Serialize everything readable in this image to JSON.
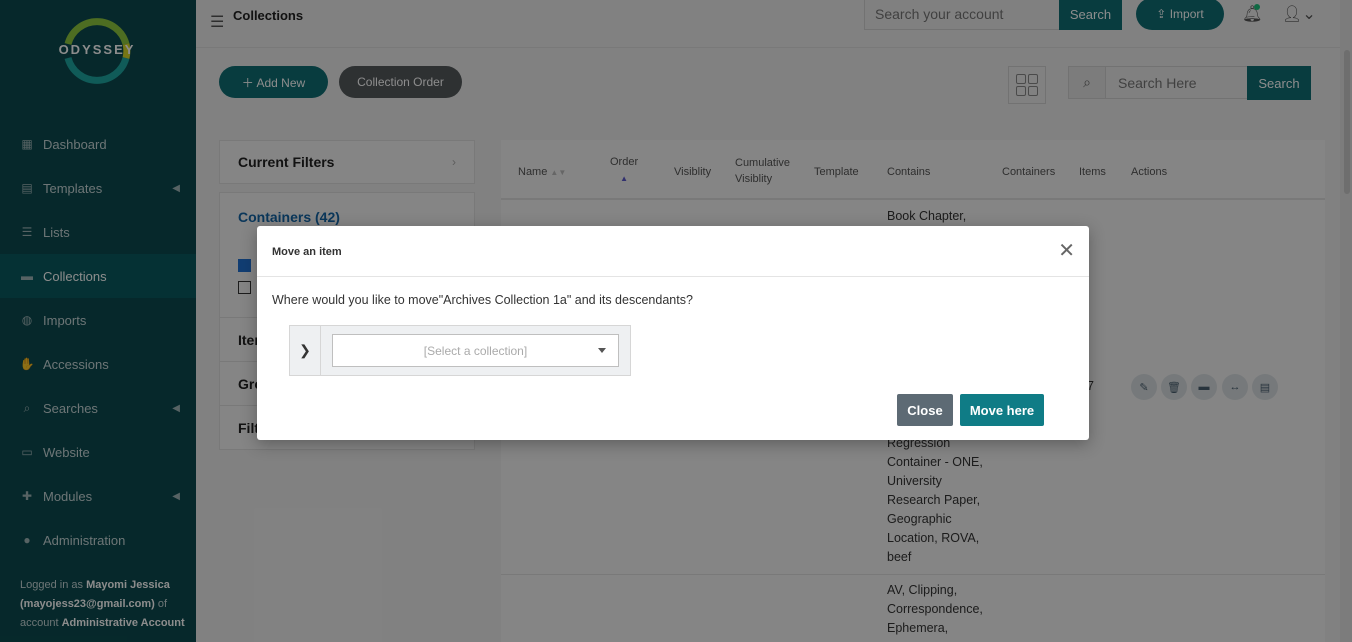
{
  "sidebar": {
    "logo_text": "ODYSSEY",
    "items": [
      {
        "label": "Dashboard",
        "icon": "dashboard-icon"
      },
      {
        "label": "Templates",
        "icon": "document-icon",
        "has_children": true
      },
      {
        "label": "Lists",
        "icon": "list-icon"
      },
      {
        "label": "Collections",
        "icon": "archive-box-icon",
        "active": true
      },
      {
        "label": "Imports",
        "icon": "database-icon"
      },
      {
        "label": "Accessions",
        "icon": "handshake-icon"
      },
      {
        "label": "Searches",
        "icon": "search-icon",
        "has_children": true
      },
      {
        "label": "Website",
        "icon": "monitor-icon"
      },
      {
        "label": "Modules",
        "icon": "puzzle-icon",
        "has_children": true
      },
      {
        "label": "Administration",
        "icon": "user-icon"
      }
    ],
    "login": {
      "prefix": "Logged in as ",
      "name": "Mayomi Jessica",
      "email": "(mayojess23@gmail.com)",
      "of_account": " of account ",
      "account": "Administrative Account"
    }
  },
  "topbar": {
    "title": "Collections",
    "search_placeholder": "Search your account",
    "search_label": "Search",
    "import_label": "Import"
  },
  "toolbar": {
    "add_new_label": "Add New",
    "collection_order_label": "Collection Order",
    "search_placeholder": "Search Here",
    "search_label": "Search"
  },
  "filters": {
    "current_filters": "Current Filters",
    "containers": "Containers (42)",
    "items": "Iter",
    "groups": "Gro",
    "filters": "Filt"
  },
  "table": {
    "headers": {
      "name": "Name",
      "order": "Order",
      "visibility": "Visiblity",
      "cumulative_1": "Cumulative",
      "cumulative_2": "Visiblity",
      "template": "Template",
      "contains": "Contains",
      "containers": "Containers",
      "items": "Items",
      "actions": "Actions"
    },
    "row1_contains_top": "Book Chapter,",
    "row1_partial_value": "7",
    "row1_contains_lines": [
      "Regression",
      "Container - ONE,",
      "University",
      "Research Paper,",
      "Geographic",
      "Location, ROVA,",
      "beef"
    ],
    "row2_contains_lines": [
      "AV, Clipping,",
      "Correspondence,",
      "Ephemera,"
    ]
  },
  "modal": {
    "title": "Move an item",
    "question": "Where would you like to move\"Archives Collection 1a\" and its descendants?",
    "select_placeholder": "[Select a collection]",
    "close_label": "Close",
    "move_label": "Move here"
  },
  "colors": {
    "sidebar_bg": "#0b4a4f",
    "accent": "#0f6e74",
    "move_button": "#0f7c86",
    "close_button": "#5d6a74"
  }
}
